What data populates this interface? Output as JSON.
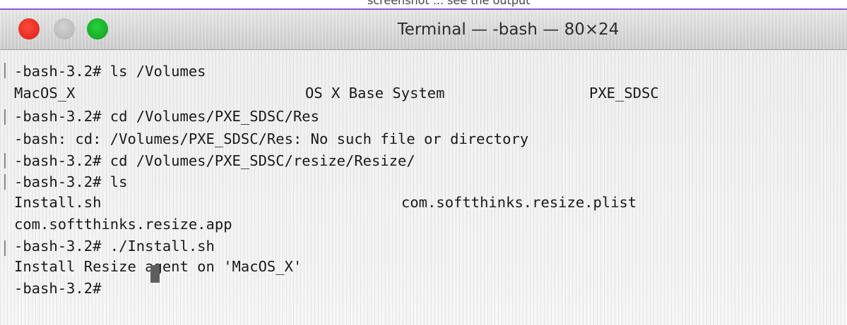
{
  "caption_fragment": "screenshot ... see the output",
  "window": {
    "title": "Terminal — -bash — 80×24"
  },
  "terminal": {
    "lines": [
      "-bash-3.2# ls /Volumes",
      "",
      "-bash-3.2# cd /Volumes/PXE_SDSC/Res",
      "-bash: cd: /Volumes/PXE_SDSC/Res: No such file or directory",
      "-bash-3.2# cd /Volumes/PXE_SDSC/resize/Resize/",
      "-bash-3.2# ls",
      "",
      "com.softthinks.resize.app",
      "-bash-3.2# ./Install.sh",
      "Install Resize agent on 'MacOS_X'",
      "-bash-3.2# "
    ],
    "volumes_listing": [
      "MacOS_X",
      "OS X Base System",
      "PXE_SDSC"
    ],
    "ls_listing": [
      "Install.sh",
      "com.softthinks.resize.plist"
    ]
  }
}
